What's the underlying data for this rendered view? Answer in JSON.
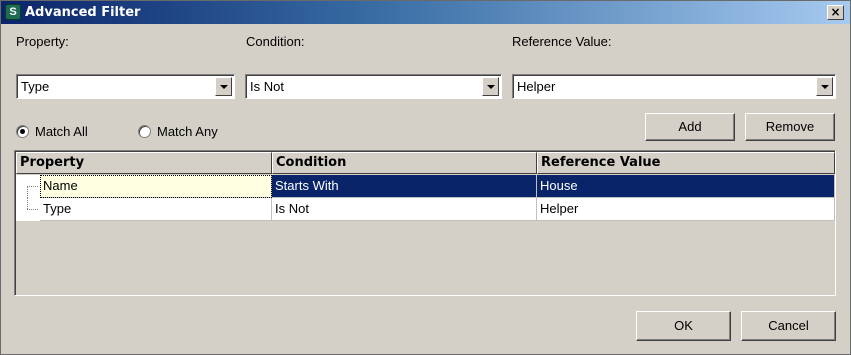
{
  "window": {
    "title": "Advanced Filter",
    "icon": "app-logo-icon",
    "close_glyph": "×"
  },
  "filter": {
    "property_label": "Property:",
    "condition_label": "Condition:",
    "reference_label": "Reference Value:",
    "property_value": "Type",
    "condition_value": "Is Not",
    "reference_value": "Helper"
  },
  "match": {
    "all_label": "Match All",
    "any_label": "Match Any",
    "selected": "all"
  },
  "buttons": {
    "add": "Add",
    "remove": "Remove",
    "ok": "OK",
    "cancel": "Cancel"
  },
  "table": {
    "columns": [
      "Property",
      "Condition",
      "Reference Value"
    ],
    "rows": [
      {
        "property": "Name",
        "condition": "Starts With",
        "reference": "House",
        "selected": true
      },
      {
        "property": "Type",
        "condition": "Is Not",
        "reference": "Helper",
        "selected": false
      }
    ]
  },
  "colors": {
    "title_start": "#0a246a",
    "title_end": "#a6caf0",
    "selection": "#0a246a",
    "face": "#d4d0c8"
  }
}
